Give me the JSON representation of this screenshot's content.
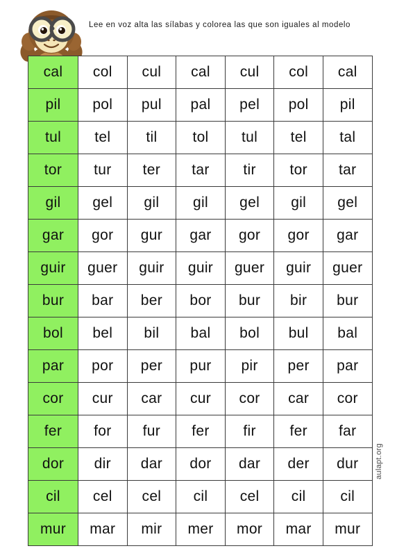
{
  "header": {
    "instruction": "Lee en voz alta las sílabas y colorea las que son iguales al modelo",
    "mascot_alt": "monkey-with-glasses-covering-ears"
  },
  "colors": {
    "model_highlight": "#90f060",
    "grid_line": "#3a3a3a",
    "text": "#111111",
    "monkey_body": "#8B5A2B",
    "monkey_face": "#F5E6B8",
    "glasses_frame": "#3a3a3a"
  },
  "worksheet": {
    "columns": 7,
    "rows": [
      {
        "model": "cal",
        "options": [
          "col",
          "cul",
          "cal",
          "cul",
          "col",
          "cal"
        ]
      },
      {
        "model": "pil",
        "options": [
          "pol",
          "pul",
          "pal",
          "pel",
          "pol",
          "pil"
        ]
      },
      {
        "model": "tul",
        "options": [
          "tel",
          "til",
          "tol",
          "tul",
          "tel",
          "tal"
        ]
      },
      {
        "model": "tor",
        "options": [
          "tur",
          "ter",
          "tar",
          "tir",
          "tor",
          "tar"
        ]
      },
      {
        "model": "gil",
        "options": [
          "gel",
          "gil",
          "gil",
          "gel",
          "gil",
          "gel"
        ]
      },
      {
        "model": "gar",
        "options": [
          "gor",
          "gur",
          "gar",
          "gor",
          "gor",
          "gar"
        ]
      },
      {
        "model": "guir",
        "options": [
          "guer",
          "guir",
          "guir",
          "guer",
          "guir",
          "guer"
        ]
      },
      {
        "model": "bur",
        "options": [
          "bar",
          "ber",
          "bor",
          "bur",
          "bir",
          "bur"
        ]
      },
      {
        "model": "bol",
        "options": [
          "bel",
          "bil",
          "bal",
          "bol",
          "bul",
          "bal"
        ]
      },
      {
        "model": "par",
        "options": [
          "por",
          "per",
          "pur",
          "pir",
          "per",
          "par"
        ]
      },
      {
        "model": "cor",
        "options": [
          "cur",
          "car",
          "cur",
          "cor",
          "car",
          "cor"
        ]
      },
      {
        "model": "fer",
        "options": [
          "for",
          "fur",
          "fer",
          "fir",
          "fer",
          "far"
        ]
      },
      {
        "model": "dor",
        "options": [
          "dir",
          "dar",
          "dor",
          "dar",
          "der",
          "dur"
        ]
      },
      {
        "model": "cil",
        "options": [
          "cel",
          "cel",
          "cil",
          "cel",
          "cil",
          "cil"
        ]
      },
      {
        "model": "mur",
        "options": [
          "mar",
          "mir",
          "mer",
          "mor",
          "mar",
          "mur"
        ]
      }
    ]
  },
  "watermark": {
    "text": "aulapt.org"
  }
}
